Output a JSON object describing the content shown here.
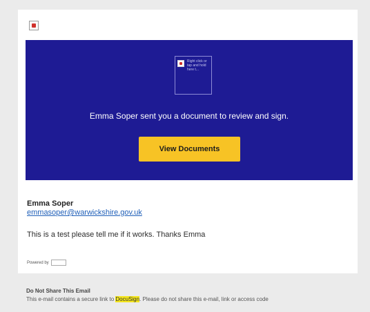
{
  "email": {
    "banner": {
      "image_placeholder_text": "Right click or tap and hold here t...",
      "headline": "Emma Soper sent you a document to review and sign.",
      "button_label": "View Documents"
    },
    "sender": {
      "name": "Emma Soper",
      "email": "emmasoper@warwickshire.gov.uk"
    },
    "message": "This is a test please tell me if it works. Thanks Emma",
    "powered_by": "Powered by",
    "colors": {
      "banner": "#1e1b94",
      "button": "#f7c325",
      "link": "#1f5fb8"
    }
  },
  "footer": {
    "title": "Do Not Share This Email",
    "text_before": "This e-mail contains a secure link to ",
    "highlighted": "DocuSign",
    "text_after": ". Please do not share this e-mail, link or access code"
  }
}
